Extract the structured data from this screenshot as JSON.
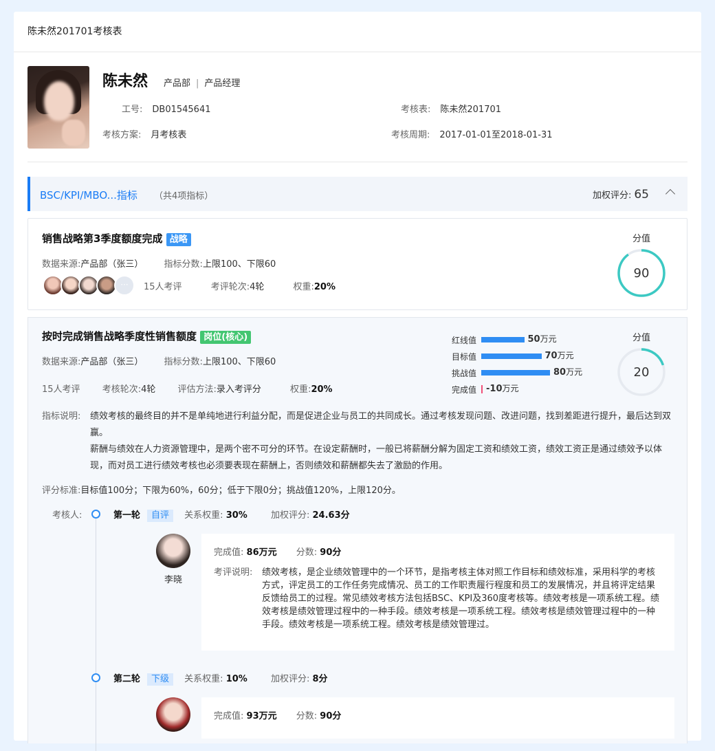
{
  "page": {
    "title": "陈未然201701考核表"
  },
  "profile": {
    "name": "陈未然",
    "dept": "产品部",
    "position": "产品经理",
    "employee_id_label": "工号:",
    "employee_id": "DB01545641",
    "sheet_label": "考核表:",
    "sheet": "陈未然201701",
    "plan_label": "考核方案:",
    "plan": "月考核表",
    "period_label": "考核周期:",
    "period": "2017-01-01至2018-01-31"
  },
  "section": {
    "title": "BSC/KPI/MBO...指标",
    "subtitle": "（共4项指标）",
    "weighted_label": "加权评分:",
    "weighted_score": "65"
  },
  "indicator1": {
    "title": "销售战略第3季度额度完成",
    "tag": "战略",
    "source_label": "数据来源:",
    "source": "产品部（张三）",
    "score_range_label": "指标分数:",
    "score_range": "上限100、下限60",
    "reviewers": "15人考评",
    "rounds_label": "考评轮次:",
    "rounds": "4轮",
    "weight_label": "权重:",
    "weight": "20%",
    "score_label": "分值",
    "score": "90",
    "score_fraction": 0.9,
    "more_icon": "···"
  },
  "indicator2": {
    "title": "按时完成销售战略季度性销售额度",
    "tag": "岗位(核心)",
    "source_label": "数据来源:",
    "source": "产品部（张三）",
    "score_range_label": "指标分数:",
    "score_range": "上限100、下限60",
    "reviewers": "15人考评",
    "rounds_label": "考核轮次:",
    "rounds": "4轮",
    "method_label": "评估方法:",
    "method": "录入考评分",
    "weight_label": "权重:",
    "weight": "20%",
    "score_label": "分值",
    "score": "20",
    "score_fraction": 0.2,
    "bars": [
      {
        "label": "红线值",
        "value": 50,
        "num": "50",
        "unit": "万元"
      },
      {
        "label": "目标值",
        "value": 70,
        "num": "70",
        "unit": "万元"
      },
      {
        "label": "挑战值",
        "value": 80,
        "num": "80",
        "unit": "万元"
      },
      {
        "label": "完成值",
        "value": -10,
        "num": "-10",
        "unit": "万元"
      }
    ],
    "desc_label": "指标说明:",
    "desc_p1": "绩效考核的最终目的并不是单纯地进行利益分配，而是促进企业与员工的共同成长。通过考核发现问题、改进问题，找到差距进行提升，最后达到双赢。",
    "desc_p2": "薪酬与绩效在人力资源管理中，是两个密不可分的环节。在设定薪酬时，一般已将薪酬分解为固定工资和绩效工资，绩效工资正是通过绩效予以体现，而对员工进行绩效考核也必须要表现在薪酬上，否则绩效和薪酬都失去了激励的作用。",
    "criteria_label": "评分标准:",
    "criteria": "目标值100分；下限为60%，60分；低于下限0分；挑战值120%，上限120分。",
    "reviewer_label": "考核人:"
  },
  "rounds": [
    {
      "name": "第一轮",
      "type": "自评",
      "rel_label": "关系权重:",
      "rel": "30%",
      "ws_label": "加权评分:",
      "ws": "24.63分",
      "person": "李晓",
      "done_label": "完成值:",
      "done": "86万元",
      "score_label": "分数:",
      "score": "90分",
      "comment_label": "考评说明:",
      "comment": "绩效考核，是企业绩效管理中的一个环节，是指考核主体对照工作目标和绩效标准，采用科学的考核方式，评定员工的工作任务完成情况、员工的工作职责履行程度和员工的发展情况，并且将评定结果反馈给员工的过程。常见绩效考核方法包括BSC、KPI及360度考核等。绩效考核是一项系统工程。绩效考核是绩效管理过程中的一种手段。绩效考核是一项系统工程。绩效考核是绩效管理过程中的一种手段。绩效考核是一项系统工程。绩效考核是绩效管理过。"
    },
    {
      "name": "第二轮",
      "type": "下级",
      "rel_label": "关系权重:",
      "rel": "10%",
      "ws_label": "加权评分:",
      "ws": "8分",
      "done_label": "完成值:",
      "done": "93万元",
      "score_label": "分数:",
      "score": "90分"
    }
  ],
  "colors": {
    "accent": "#1a7cf5",
    "ring": "#3cc9c3",
    "bar": "#2f8df3",
    "tag_green": "#43c671"
  }
}
